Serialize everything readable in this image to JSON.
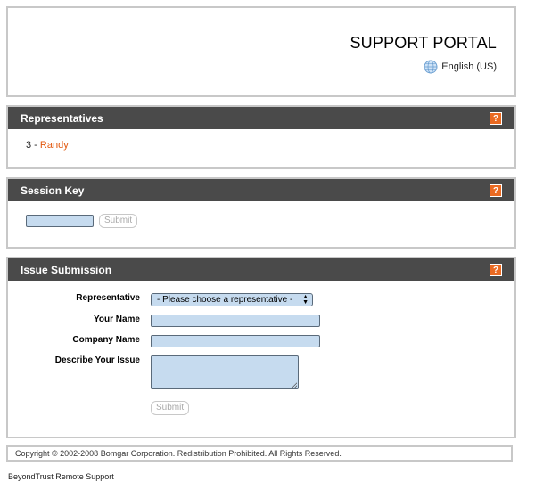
{
  "header": {
    "title": "SUPPORT PORTAL",
    "language": "English (US)"
  },
  "representatives": {
    "heading": "Representatives",
    "help_label": "?",
    "entry_prefix": "3 - ",
    "entry_name": "Randy"
  },
  "session_key": {
    "heading": "Session Key",
    "help_label": "?",
    "input_value": "",
    "submit_label": "Submit"
  },
  "issue": {
    "heading": "Issue Submission",
    "help_label": "?",
    "rep_label": "Representative",
    "rep_selected": "- Please choose a representative -",
    "name_label": "Your Name",
    "name_value": "",
    "company_label": "Company Name",
    "company_value": "",
    "describe_label": "Describe Your Issue",
    "describe_value": "",
    "submit_label": "Submit"
  },
  "footer": {
    "copyright": "Copyright © 2002-2008 Bomgar Corporation. Redistribution Prohibited. All Rights Reserved.",
    "brand": "BeyondTrust Remote Support"
  },
  "colors": {
    "accent": "#ea6a22",
    "header_bar": "#4a4a4a",
    "input_bg": "#c6dbef",
    "link": "#e2570d"
  },
  "icons": {
    "language": "globe-icon",
    "help": "help-icon"
  }
}
